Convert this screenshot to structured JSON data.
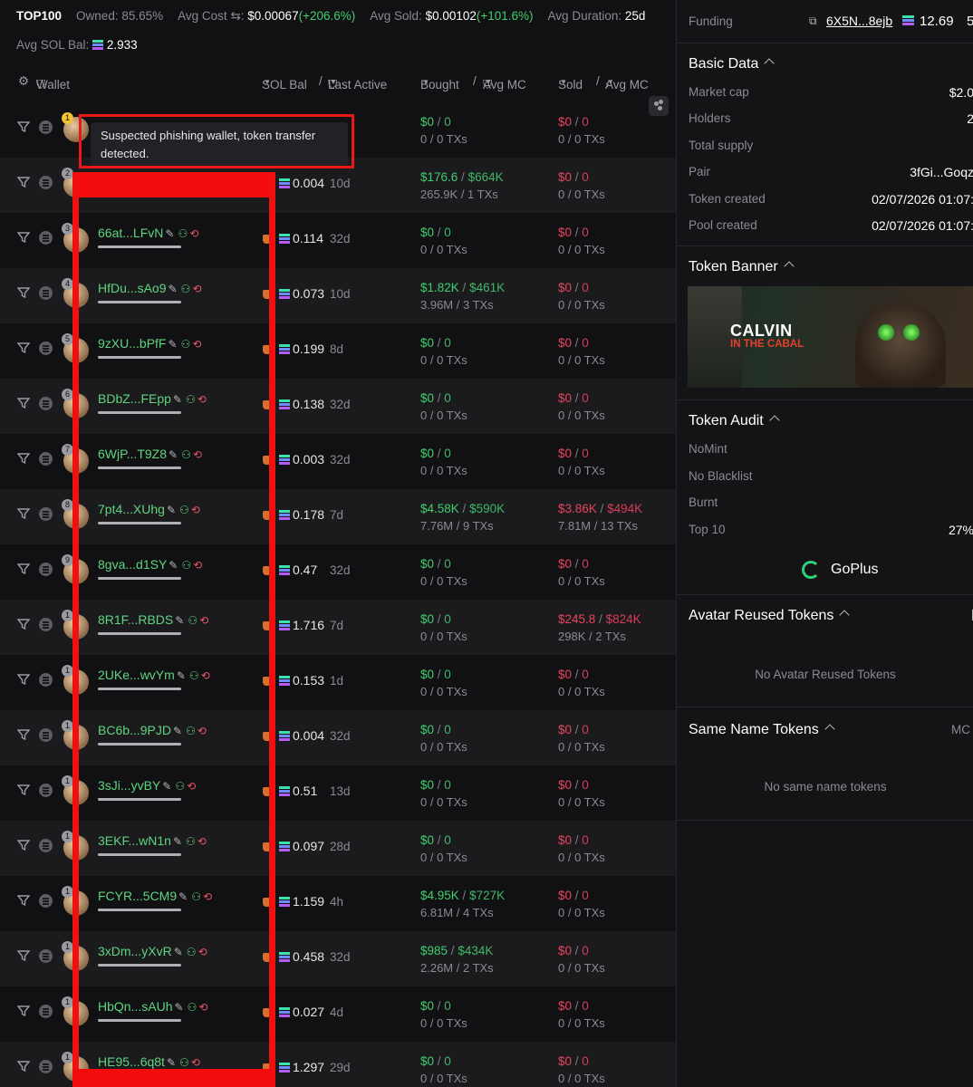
{
  "stats": {
    "top_label": "TOP100",
    "owned_label": "Owned:",
    "owned_value": "85.65%",
    "avg_cost_label": "Avg Cost",
    "avg_cost_value": "$0.00067",
    "avg_cost_change": "(+206.6%)",
    "avg_sold_label": "Avg Sold:",
    "avg_sold_value": "$0.00102",
    "avg_sold_change": "(+101.6%)",
    "avg_duration_label": "Avg Duration:",
    "avg_duration_value": "25d",
    "avg_sol_bal_label": "Avg SOL Bal:",
    "avg_sol_bal_value": "2.933"
  },
  "header": {
    "wallet": "Wallet",
    "sol_bal": "SOL Bal",
    "last_active": "Last Active",
    "bought": "Bought",
    "avg_mc_1": "Avg MC",
    "sold": "Sold",
    "avg_mc_2": "Avg MC",
    "slash": "/"
  },
  "tooltip": "Suspected phishing wallet, token transfer detected.",
  "rows": [
    {
      "rank": "1",
      "addr": "",
      "sol": "",
      "active": "",
      "b_usd": "$0",
      "b_mc": "0",
      "b_sub": "0 / 0 TXs",
      "s_usd": "$0",
      "s_mc": "0",
      "s_sub": "0 / 0 TXs"
    },
    {
      "rank": "2",
      "addr": "",
      "sol": "0.004",
      "active": "10d",
      "b_usd": "$176.6",
      "b_mc": "$664K",
      "b_sub": "265.9K / 1 TXs",
      "s_usd": "$0",
      "s_mc": "0",
      "s_sub": "0 / 0 TXs"
    },
    {
      "rank": "3",
      "addr": "66at...LFvN",
      "sol": "0.114",
      "active": "32d",
      "b_usd": "$0",
      "b_mc": "0",
      "b_sub": "0 / 0 TXs",
      "s_usd": "$0",
      "s_mc": "0",
      "s_sub": "0 / 0 TXs"
    },
    {
      "rank": "4",
      "addr": "HfDu...sAo9",
      "sol": "0.073",
      "active": "10d",
      "b_usd": "$1.82K",
      "b_mc": "$461K",
      "b_sub": "3.96M / 3 TXs",
      "s_usd": "$0",
      "s_mc": "0",
      "s_sub": "0 / 0 TXs"
    },
    {
      "rank": "5",
      "addr": "9zXU...bPfF",
      "sol": "0.199",
      "active": "8d",
      "b_usd": "$0",
      "b_mc": "0",
      "b_sub": "0 / 0 TXs",
      "s_usd": "$0",
      "s_mc": "0",
      "s_sub": "0 / 0 TXs"
    },
    {
      "rank": "6",
      "addr": "BDbZ...FEpp",
      "sol": "0.138",
      "active": "32d",
      "b_usd": "$0",
      "b_mc": "0",
      "b_sub": "0 / 0 TXs",
      "s_usd": "$0",
      "s_mc": "0",
      "s_sub": "0 / 0 TXs"
    },
    {
      "rank": "7",
      "addr": "6WjP...T9Z8",
      "sol": "0.003",
      "active": "32d",
      "b_usd": "$0",
      "b_mc": "0",
      "b_sub": "0 / 0 TXs",
      "s_usd": "$0",
      "s_mc": "0",
      "s_sub": "0 / 0 TXs"
    },
    {
      "rank": "8",
      "addr": "7pt4...XUhg",
      "sol": "0.178",
      "active": "7d",
      "b_usd": "$4.58K",
      "b_mc": "$590K",
      "b_sub": "7.76M / 9 TXs",
      "s_usd": "$3.86K",
      "s_mc": "$494K",
      "s_sub": "7.81M / 13 TXs"
    },
    {
      "rank": "9",
      "addr": "8gva...d1SY",
      "sol": "0.47",
      "active": "32d",
      "b_usd": "$0",
      "b_mc": "0",
      "b_sub": "0 / 0 TXs",
      "s_usd": "$0",
      "s_mc": "0",
      "s_sub": "0 / 0 TXs"
    },
    {
      "rank": "1",
      "addr": "8R1F...RBDS",
      "sol": "1.716",
      "active": "7d",
      "b_usd": "$0",
      "b_mc": "0",
      "b_sub": "0 / 0 TXs",
      "s_usd": "$245.8",
      "s_mc": "$824K",
      "s_sub": "298K / 2 TXs"
    },
    {
      "rank": "1",
      "addr": "2UKe...wvYm",
      "sol": "0.153",
      "active": "1d",
      "b_usd": "$0",
      "b_mc": "0",
      "b_sub": "0 / 0 TXs",
      "s_usd": "$0",
      "s_mc": "0",
      "s_sub": "0 / 0 TXs"
    },
    {
      "rank": "1",
      "addr": "BC6b...9PJD",
      "sol": "0.004",
      "active": "32d",
      "b_usd": "$0",
      "b_mc": "0",
      "b_sub": "0 / 0 TXs",
      "s_usd": "$0",
      "s_mc": "0",
      "s_sub": "0 / 0 TXs"
    },
    {
      "rank": "1",
      "addr": "3sJi...yvBY",
      "sol": "0.51",
      "active": "13d",
      "b_usd": "$0",
      "b_mc": "0",
      "b_sub": "0 / 0 TXs",
      "s_usd": "$0",
      "s_mc": "0",
      "s_sub": "0 / 0 TXs"
    },
    {
      "rank": "1",
      "addr": "3EKF...wN1n",
      "sol": "0.097",
      "active": "28d",
      "b_usd": "$0",
      "b_mc": "0",
      "b_sub": "0 / 0 TXs",
      "s_usd": "$0",
      "s_mc": "0",
      "s_sub": "0 / 0 TXs"
    },
    {
      "rank": "1",
      "addr": "FCYR...5CM9",
      "sol": "1.159",
      "active": "4h",
      "b_usd": "$4.95K",
      "b_mc": "$727K",
      "b_sub": "6.81M / 4 TXs",
      "s_usd": "$0",
      "s_mc": "0",
      "s_sub": "0 / 0 TXs"
    },
    {
      "rank": "1",
      "addr": "3xDm...yXvR",
      "sol": "0.458",
      "active": "32d",
      "b_usd": "$985",
      "b_mc": "$434K",
      "b_sub": "2.26M / 2 TXs",
      "s_usd": "$0",
      "s_mc": "0",
      "s_sub": "0 / 0 TXs"
    },
    {
      "rank": "1",
      "addr": "HbQn...sAUh",
      "sol": "0.027",
      "active": "4d",
      "b_usd": "$0",
      "b_mc": "0",
      "b_sub": "0 / 0 TXs",
      "s_usd": "$0",
      "s_mc": "0",
      "s_sub": "0 / 0 TXs"
    },
    {
      "rank": "1",
      "addr": "HE95...6q8t",
      "sol": "1.297",
      "active": "29d",
      "b_usd": "$0",
      "b_mc": "0",
      "b_sub": "0 / 0 TXs",
      "s_usd": "$0",
      "s_mc": "0",
      "s_sub": "0 / 0 TXs"
    }
  ],
  "right": {
    "funding_label": "Funding",
    "funding_addr": "6X5N...8ejb",
    "funding_amount": "12.69",
    "funding_extra": "5",
    "basic_data_title": "Basic Data",
    "basic": [
      {
        "label": "Market cap",
        "value": "$2.0"
      },
      {
        "label": "Holders",
        "value": "2"
      },
      {
        "label": "Total supply",
        "value": ""
      },
      {
        "label": "Pair",
        "value": "3fGi...Goqz"
      },
      {
        "label": "Token created",
        "value": "02/07/2026 01:07:"
      },
      {
        "label": "Pool created",
        "value": "02/07/2026 01:07:"
      }
    ],
    "banner_title": "Token Banner",
    "banner_text_1": "CALVIN",
    "banner_text_2": "IN THE CABAL",
    "audit_title": "Token Audit",
    "audit": [
      {
        "label": "NoMint",
        "value": ""
      },
      {
        "label": "No Blacklist",
        "value": ""
      },
      {
        "label": "Burnt",
        "value": ""
      },
      {
        "label": "Top 10",
        "value": "27%"
      }
    ],
    "goplus": "GoPlus",
    "avatar_reused_title": "Avatar Reused Tokens",
    "avatar_reused_empty": "No Avatar Reused Tokens",
    "same_name_title": "Same Name Tokens",
    "same_name_mc": "MC",
    "same_name_empty": "No same name tokens"
  },
  "colors": {
    "positive": "#3ecf6e",
    "negative": "#e8455e",
    "highlight_red": "#f01010"
  }
}
